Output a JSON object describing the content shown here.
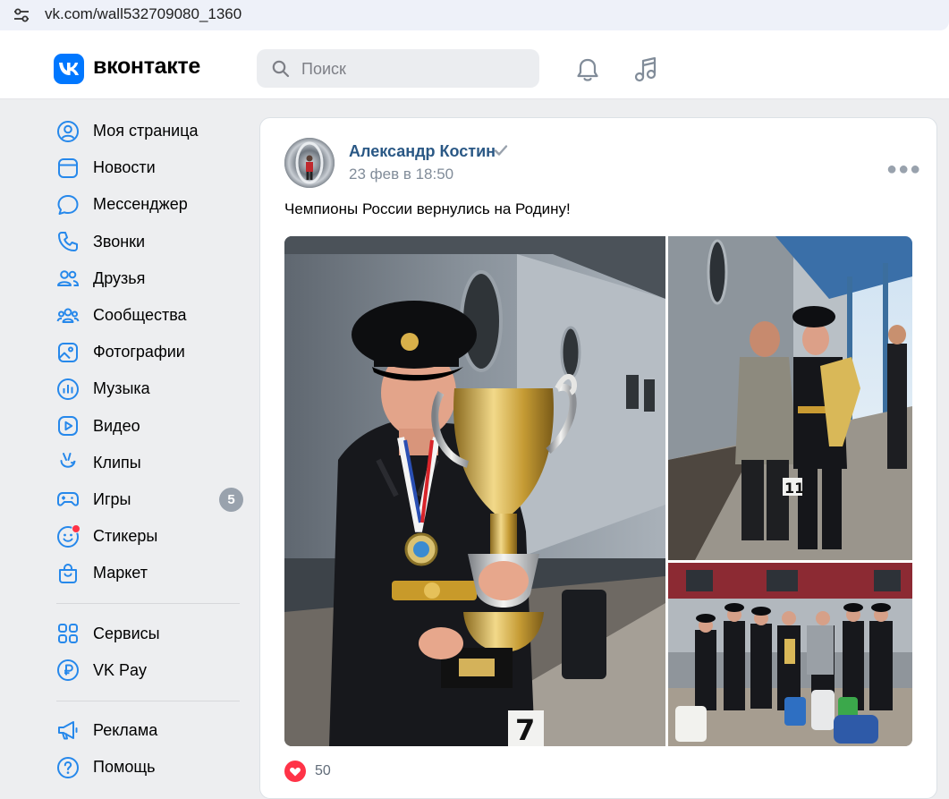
{
  "browser": {
    "url": "vk.com/wall532709080_1360"
  },
  "header": {
    "logo_text": "вконтакте",
    "search_placeholder": "Поиск"
  },
  "sidebar": {
    "items": [
      {
        "label": "Моя страница",
        "icon": "profile-icon"
      },
      {
        "label": "Новости",
        "icon": "news-icon"
      },
      {
        "label": "Мессенджер",
        "icon": "messenger-icon"
      },
      {
        "label": "Звонки",
        "icon": "phone-icon"
      },
      {
        "label": "Друзья",
        "icon": "friends-icon"
      },
      {
        "label": "Сообщества",
        "icon": "communities-icon"
      },
      {
        "label": "Фотографии",
        "icon": "photos-icon"
      },
      {
        "label": "Музыка",
        "icon": "music-icon"
      },
      {
        "label": "Видео",
        "icon": "video-icon"
      },
      {
        "label": "Клипы",
        "icon": "clips-icon"
      },
      {
        "label": "Игры",
        "icon": "games-icon",
        "badge": "5"
      },
      {
        "label": "Стикеры",
        "icon": "stickers-icon"
      },
      {
        "label": "Маркет",
        "icon": "market-icon"
      }
    ],
    "items2": [
      {
        "label": "Сервисы",
        "icon": "services-icon"
      },
      {
        "label": "VK Pay",
        "icon": "vkpay-icon"
      }
    ],
    "items3": [
      {
        "label": "Реклама",
        "icon": "ads-icon"
      },
      {
        "label": "Помощь",
        "icon": "help-icon"
      }
    ]
  },
  "post": {
    "author": "Александр Костин",
    "date": "23 фев в 18:50",
    "text": "Чемпионы России вернулись на Родину!",
    "likes": "50"
  },
  "colors": {
    "accent": "#0077ff",
    "link": "#2a5885",
    "like": "#ff3347",
    "background": "#edeef0"
  }
}
